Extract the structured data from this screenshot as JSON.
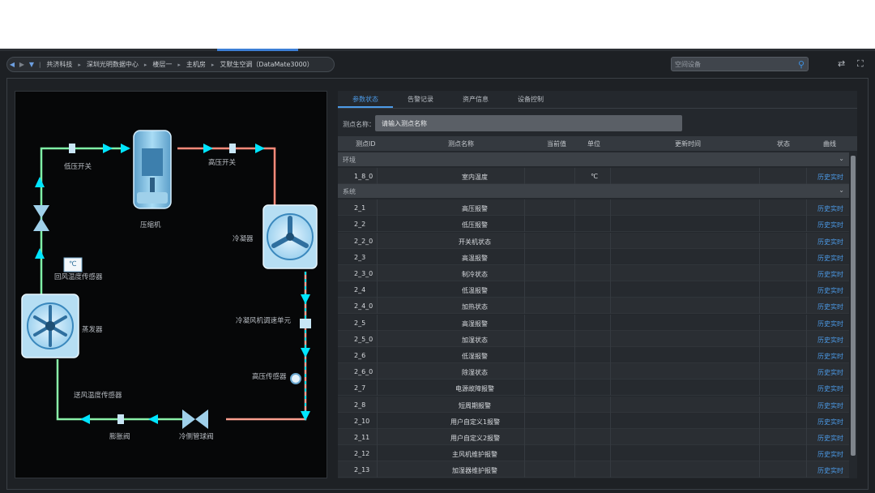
{
  "breadcrumb": {
    "items": [
      "共济科技",
      "深圳光明数据中心",
      "楼层一",
      "主机房",
      "艾默生空调（DataMate3000）"
    ]
  },
  "search": {
    "placeholder": "空间设备"
  },
  "diagram": {
    "labels": {
      "low_pressure_switch": "低压开关",
      "compressor": "压缩机",
      "high_pressure_switch": "高压开关",
      "condenser": "冷凝器",
      "return_air_sensor": "回风温度传感器",
      "return_air_unit": "℃",
      "evaporator": "蒸发器",
      "condenser_fan_unit": "冷凝风机调速单元",
      "high_pressure_sensor": "高压传感器",
      "supply_air_sensor": "送风温度传感器",
      "expansion_valve": "膨胀阀",
      "ball_valve": "冷侧管球阀"
    },
    "colors": {
      "low_side": "#7ff0a6",
      "high_side": "#ff8a7a",
      "liquid": "#00e5ff"
    }
  },
  "tabs": [
    {
      "label": "参数状态",
      "active": true
    },
    {
      "label": "告警记录",
      "active": false
    },
    {
      "label": "资产信息",
      "active": false
    },
    {
      "label": "设备控制",
      "active": false
    }
  ],
  "filter": {
    "label": "测点名称：",
    "placeholder": "请输入测点名称"
  },
  "table": {
    "headers": {
      "id": "测点ID",
      "name": "测点名称",
      "value": "当前值",
      "unit": "单位",
      "time": "更新时间",
      "status": "状态",
      "curve": "曲线"
    },
    "history_label": "历史",
    "realtime_label": "实时",
    "groups": [
      {
        "name": "环境",
        "rows": [
          {
            "id": "1_8_0",
            "name": "室内温度",
            "unit": "℃"
          }
        ]
      },
      {
        "name": "系统",
        "rows": [
          {
            "id": "2_1",
            "name": "高压报警",
            "unit": ""
          },
          {
            "id": "2_2",
            "name": "低压报警",
            "unit": ""
          },
          {
            "id": "2_2_0",
            "name": "开关机状态",
            "unit": ""
          },
          {
            "id": "2_3",
            "name": "高温报警",
            "unit": ""
          },
          {
            "id": "2_3_0",
            "name": "制冷状态",
            "unit": ""
          },
          {
            "id": "2_4",
            "name": "低温报警",
            "unit": ""
          },
          {
            "id": "2_4_0",
            "name": "加热状态",
            "unit": ""
          },
          {
            "id": "2_5",
            "name": "高湿报警",
            "unit": ""
          },
          {
            "id": "2_5_0",
            "name": "加湿状态",
            "unit": ""
          },
          {
            "id": "2_6",
            "name": "低湿报警",
            "unit": ""
          },
          {
            "id": "2_6_0",
            "name": "除湿状态",
            "unit": ""
          },
          {
            "id": "2_7",
            "name": "电源故障报警",
            "unit": ""
          },
          {
            "id": "2_8",
            "name": "短周期报警",
            "unit": ""
          },
          {
            "id": "2_10",
            "name": "用户自定义1报警",
            "unit": ""
          },
          {
            "id": "2_11",
            "name": "用户自定义2报警",
            "unit": ""
          },
          {
            "id": "2_12",
            "name": "主风机维护报警",
            "unit": ""
          },
          {
            "id": "2_13",
            "name": "加湿器维护报警",
            "unit": ""
          }
        ]
      }
    ]
  }
}
